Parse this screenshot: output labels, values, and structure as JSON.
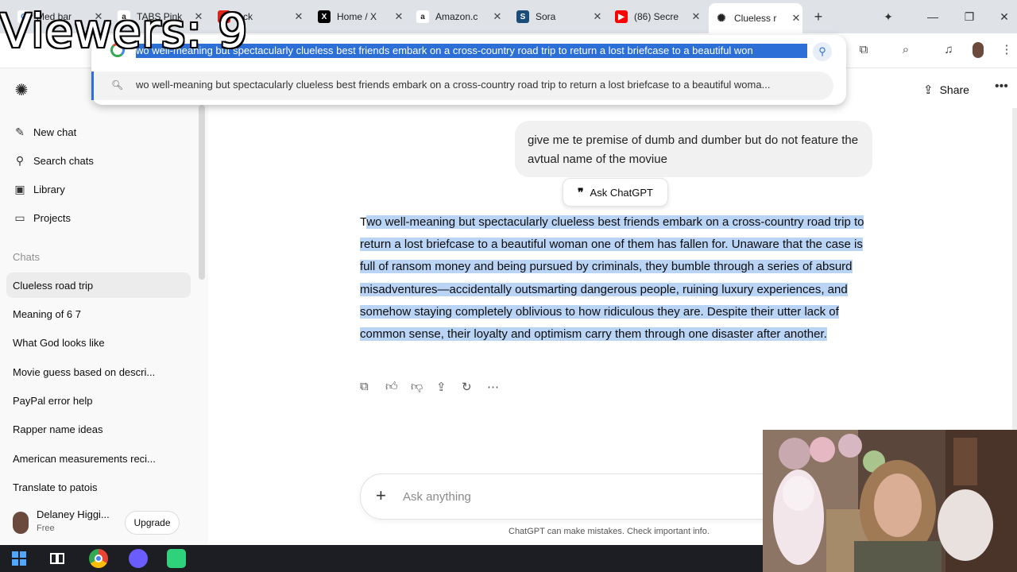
{
  "overlay": {
    "viewers": "Viewers: 9"
  },
  "browser": {
    "tabs": [
      {
        "title": "Med bar",
        "favicon": "google-icon",
        "color": "#4285f4"
      },
      {
        "title": "TABS Pink",
        "favicon": "amazon-icon",
        "color": "#222222"
      },
      {
        "title": "Ack",
        "favicon": "acrobat-icon",
        "color": "#e2231a"
      },
      {
        "title": "Home / X",
        "favicon": "x-icon",
        "color": "#000000"
      },
      {
        "title": "Amazon.c",
        "favicon": "amazon-icon",
        "color": "#222222"
      },
      {
        "title": "Sora",
        "favicon": "sora-icon",
        "color": "#1a4d7a"
      },
      {
        "title": "(86) Secre",
        "favicon": "youtube-icon",
        "color": "#ff0000"
      },
      {
        "title": "Clueless r",
        "favicon": "openai-icon",
        "color": "#222222",
        "active": true
      }
    ],
    "omnibox": {
      "input": "wo well-meaning but spectacularly clueless best friends embark on a cross-country road trip to return a lost briefcase to a beautiful won",
      "suggestion": "wo well-meaning but spectacularly clueless best friends embark on a cross-country road trip to return a lost briefcase to a beautiful woma..."
    }
  },
  "sidebar": {
    "nav": [
      {
        "label": "New chat",
        "icon": "compose-icon"
      },
      {
        "label": "Search chats",
        "icon": "search-icon"
      },
      {
        "label": "Library",
        "icon": "library-icon"
      },
      {
        "label": "Projects",
        "icon": "folder-icon"
      }
    ],
    "chats_heading": "Chats",
    "chats": [
      "Clueless road trip",
      "Meaning of 6 7",
      "What God looks like",
      "Movie guess based on descri...",
      "PayPal error help",
      "Rapper name ideas",
      "American measurements reci...",
      "Translate to patois"
    ],
    "profile": {
      "name": "Delaney Higgi...",
      "plan": "Free",
      "upgrade": "Upgrade"
    }
  },
  "main": {
    "share": "Share",
    "user_message": "give me te premise of dumb and dumber but do not feature the avtual name of the moviue",
    "ask_button": "Ask ChatGPT",
    "answer_first": "T",
    "answer_rest": "wo well-meaning but spectacularly clueless best friends embark on a cross-country road trip to return a lost briefcase to a beautiful woman one of them has fallen for. Unaware that the case is full of ransom money and being pursued by criminals, they bumble through a series of absurd misadventures—accidentally outsmarting dangerous people, ruining luxury experiences, and somehow staying completely oblivious to how ridiculous they are. Despite their utter lack of common sense, their loyalty and optimism carry them through one disaster after another.",
    "composer_placeholder": "Ask anything",
    "disclaimer": "ChatGPT can make mistakes. Check important info."
  }
}
